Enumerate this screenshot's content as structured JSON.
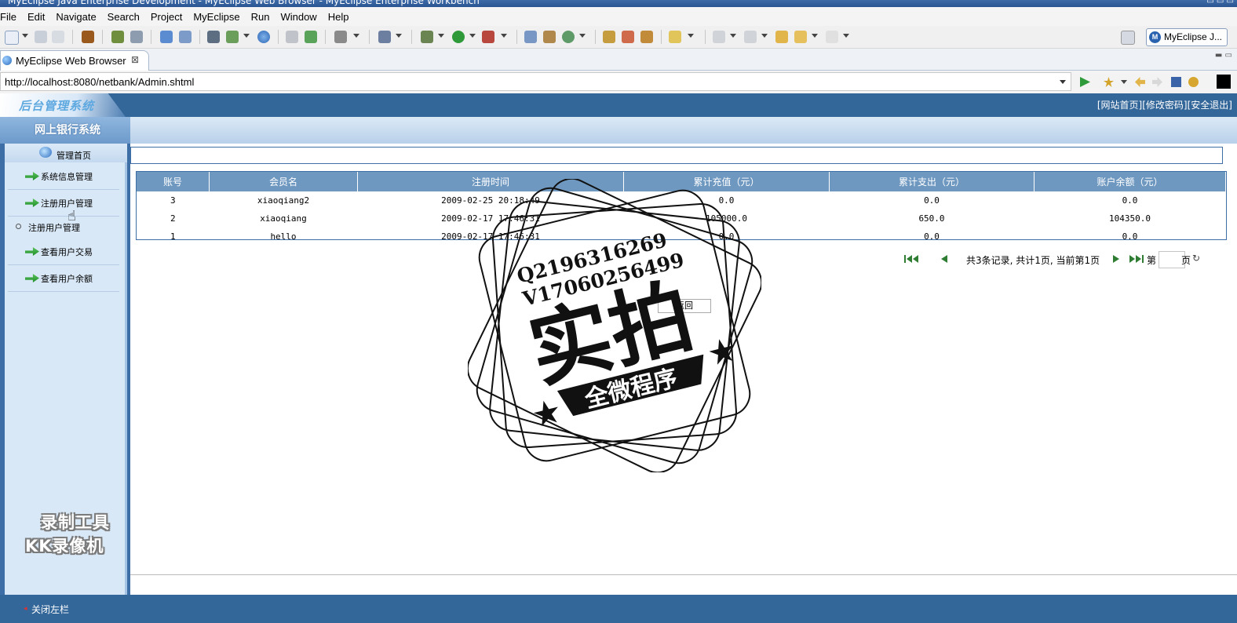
{
  "window": {
    "title": "MyEclipse Java Enterprise Development - MyEclipse Web Browser - MyEclipse Enterprise Workbench"
  },
  "menu": [
    "File",
    "Edit",
    "Navigate",
    "Search",
    "Project",
    "MyEclipse",
    "Run",
    "Window",
    "Help"
  ],
  "toolbar": {
    "perspective_label": "MyEclipse J...",
    "perspective_icon_letter": "M"
  },
  "editor_tab": {
    "label": "MyEclipse Web Browser",
    "close": "⊠"
  },
  "browser": {
    "url": "http://localhost:8080/netbank/Admin.shtml"
  },
  "header": {
    "logo": "后台管理系统",
    "links": [
      "[网站首页]",
      "[修改密码]",
      "[安全退出]"
    ],
    "system_name": "网上银行系统"
  },
  "sidebar": {
    "home": "管理首页",
    "items": [
      "系统信息管理",
      "注册用户管理",
      "注册用户管理",
      "查看用户交易",
      "查看用户余额"
    ]
  },
  "table": {
    "headers": [
      "账号",
      "会员名",
      "注册时间",
      "累计充值（元）",
      "累计支出（元）",
      "账户余额（元）"
    ],
    "rows": [
      [
        "3",
        "xiaoqiang2",
        "2009-02-25 20:18:49",
        "0.0",
        "0.0",
        "0.0"
      ],
      [
        "2",
        "xiaoqiang",
        "2009-02-17 17:46:31",
        "105000.0",
        "650.0",
        "104350.0"
      ],
      [
        "1",
        "hello",
        "2009-02-17 17:46:31",
        "0.0",
        "0.0",
        "0.0"
      ]
    ]
  },
  "pager": {
    "summary": "共3条记录, 共计1页, 当前第1页",
    "page_prefix": "第",
    "page_suffix": "页",
    "page_value": ""
  },
  "back_button": "返回",
  "footer": {
    "close_sidebar": "关闭左栏"
  },
  "overlay": {
    "watermark_lines": [
      "录制工具",
      "KK录像机"
    ],
    "stamp": {
      "line1": "Q2196316269",
      "line2": "V17060256499",
      "big": "实拍",
      "banner": "全微程序"
    }
  }
}
